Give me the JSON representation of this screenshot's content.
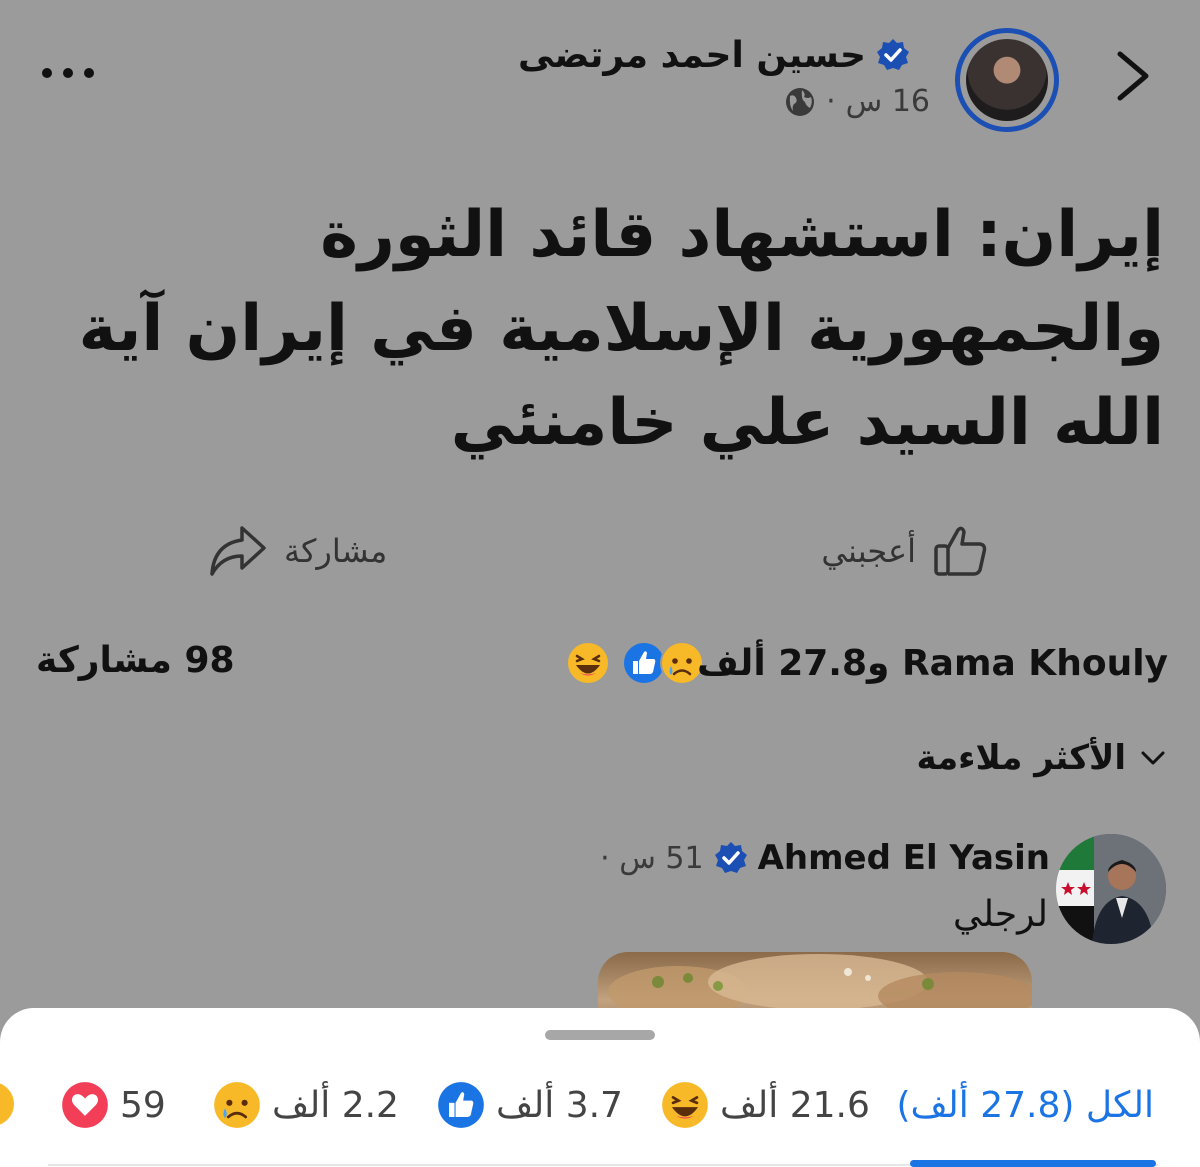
{
  "header": {
    "author_name": "حسين  احمد مرتضى",
    "time": "16 س",
    "separator": "·",
    "icons": {
      "back": "chevron-right-icon",
      "verified": "verified-badge-icon",
      "audience": "globe-icon",
      "more": "more-dots-icon"
    }
  },
  "post": {
    "text": "إيران: استشهاد قائد الثورة والجمهورية الإسلامية في إيران آية الله السيد علي خامنئي"
  },
  "actions": {
    "like_label": "أعجبني",
    "share_label": "مشاركة"
  },
  "summary": {
    "reactions_text": "Rama Khouly و27.8 ألف",
    "shares_text": "98 مشاركة",
    "reaction_icons": [
      "haha-icon",
      "like-icon",
      "sad-icon"
    ]
  },
  "sort": {
    "label": "الأكثر ملاءمة"
  },
  "comment": {
    "name": "Ahmed El Yasin",
    "time": "51 س ·",
    "text": "لرجلي"
  },
  "reaction_sheet": {
    "tabs": [
      {
        "label": "الكل (27.8 ألف)",
        "icon": null
      },
      {
        "label": "21.6 ألف",
        "icon": "haha-icon"
      },
      {
        "label": "3.7 ألف",
        "icon": "like-icon"
      },
      {
        "label": "2.2 ألف",
        "icon": "sad-icon"
      },
      {
        "label": "59",
        "icon": "love-icon"
      }
    ]
  },
  "colors": {
    "background": "#9b9b9b",
    "accent": "#1b74e4",
    "verified": "#1b4fb4",
    "haha": "#f7b928",
    "love": "#f33e58"
  }
}
